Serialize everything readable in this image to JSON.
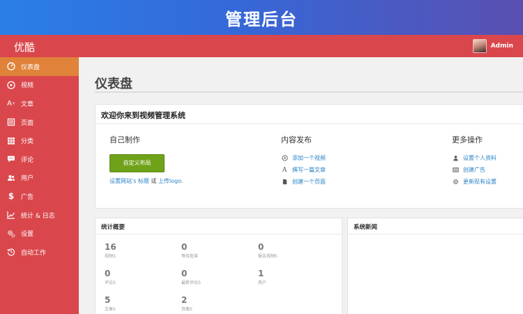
{
  "banner": {
    "title": "管理后台"
  },
  "adminbar": {
    "brand": "优酷",
    "user_name": "Admin"
  },
  "sidebar": {
    "items": [
      {
        "label": "仪表盘",
        "icon": "dashboard-icon",
        "active": true
      },
      {
        "label": "视频",
        "icon": "play-icon"
      },
      {
        "label": "文章",
        "icon": "text-icon"
      },
      {
        "label": "页面",
        "icon": "page-icon"
      },
      {
        "label": "分类",
        "icon": "grid-icon"
      },
      {
        "label": "评论",
        "icon": "comment-icon"
      },
      {
        "label": "用户",
        "icon": "users-icon"
      },
      {
        "label": "广告",
        "icon": "dollar-icon"
      },
      {
        "label": "统计 & 日志",
        "icon": "chart-icon"
      },
      {
        "label": "设置",
        "icon": "gears-icon"
      },
      {
        "label": "自动工作",
        "icon": "history-icon"
      }
    ]
  },
  "main": {
    "title": "仪表盘",
    "welcome": {
      "heading": "欢迎你来到视频管理系统",
      "col1": {
        "title": "自己制作",
        "button": "自定义布局",
        "hint_pre": "设置网站's 标题",
        "hint_mid": " 或 ",
        "hint_link": "上传logo."
      },
      "col2": {
        "title": "内容发布",
        "actions": [
          "添加一个视频",
          "撰写一篇文章",
          "创建一个页面"
        ]
      },
      "col3": {
        "title": "更多操作",
        "actions": [
          "设置个人资料",
          "创建广告",
          "更新现有设置"
        ]
      }
    },
    "stats": {
      "title": "统计概要",
      "items": [
        {
          "num": "16",
          "label": "视频S"
        },
        {
          "num": "0",
          "label": "等待批准"
        },
        {
          "num": "0",
          "label": "报告视频S"
        },
        {
          "num": "0",
          "label": "评论S"
        },
        {
          "num": "0",
          "label": "最新评论S"
        },
        {
          "num": "1",
          "label": "用户"
        },
        {
          "num": "5",
          "label": "文章S"
        },
        {
          "num": "2",
          "label": "页面S"
        }
      ]
    },
    "news": {
      "title": "系统新闻"
    }
  }
}
